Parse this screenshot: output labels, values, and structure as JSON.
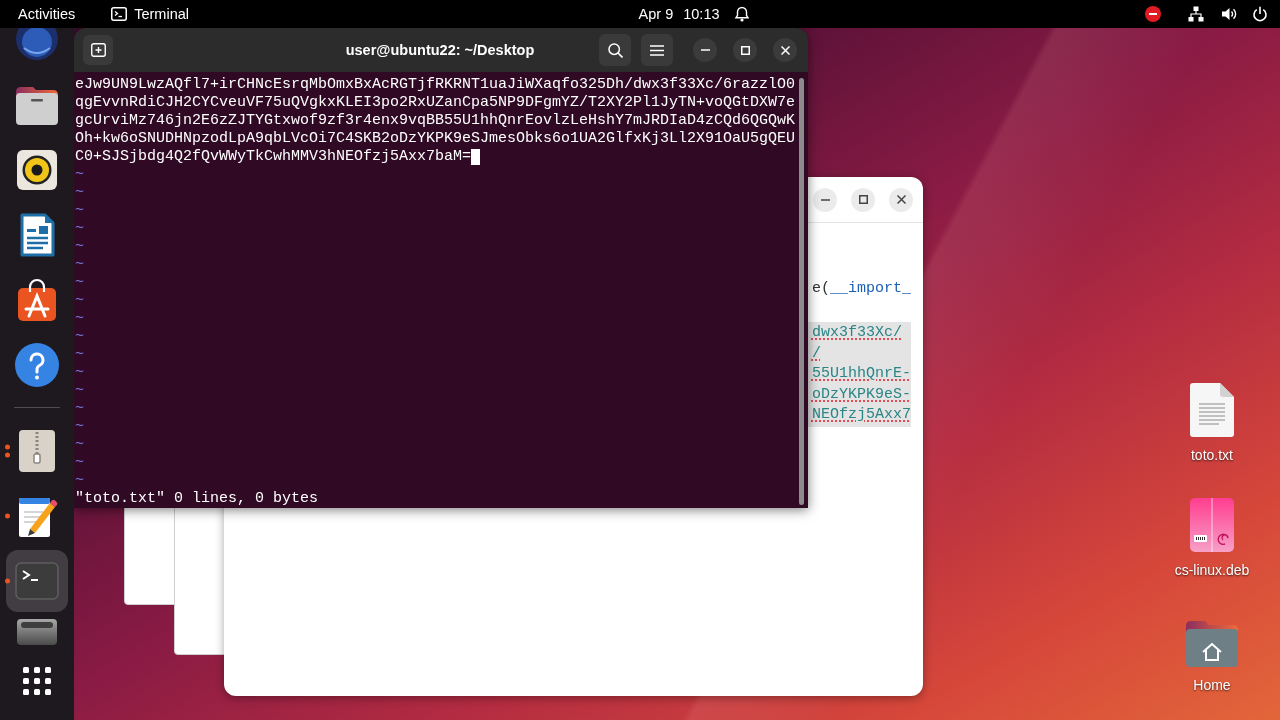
{
  "top_bar": {
    "activities": "Activities",
    "app_menu": "Terminal",
    "date": "Apr 9",
    "time": "10:13"
  },
  "dock": {
    "pinned": [
      {
        "kind": "globe",
        "selected": false,
        "running": false,
        "multiple_windows": false
      },
      {
        "kind": "folder",
        "selected": false,
        "running": false,
        "multiple_windows": false
      },
      {
        "kind": "speaker",
        "selected": false,
        "running": false,
        "multiple_windows": false
      },
      {
        "kind": "writer",
        "selected": false,
        "running": false,
        "multiple_windows": false
      },
      {
        "kind": "store",
        "selected": false,
        "running": false,
        "multiple_windows": false
      },
      {
        "kind": "help",
        "selected": false,
        "running": false,
        "multiple_windows": false
      }
    ],
    "running_apps": [
      {
        "kind": "archive",
        "selected": false,
        "running": true,
        "multiple_windows": true
      },
      {
        "kind": "editor",
        "selected": false,
        "running": true,
        "multiple_windows": false
      },
      {
        "kind": "terminal",
        "selected": true,
        "running": true,
        "multiple_windows": false
      },
      {
        "kind": "drive",
        "selected": false,
        "running": false,
        "multiple_windows": false
      }
    ]
  },
  "terminal": {
    "title": "user@ubuntu22: ~/Desktop",
    "rows": [
      "eJw9UN9LwzAQfl7+irCHNcEsrqMbOmxBxAcRGTjfRKRNT1uaJiWXaqfo325Dh/dwx3f33Xc/6razzlO0",
      "qgEvvnRdiCJH2CYCveuVF75uQVgkxKLEI3po2RxUZanCpa5NP9DFgmYZ/T2XY2Pl1JyTN+voQGtDXW7e",
      "gcUrviMz746jn2E6zZJTYGtxwof9zf3r4enx9vqBB55U1hhQnrEovlzLeHshY7mJRDIaD4zCQd6QGQwK",
      "Oh+kw6oSNUDHNpzodLpA9qbLVcOi7C4SKB2oDzYKPK9eSJmesObks6o1UA2GlfxKj3Ll2X91OaU5gQEU",
      "C0+SJSjbdg4Q2fQvWWyTkCwhMMV3hNEOfzj5Axx7baM="
    ],
    "cursor": true,
    "empty_rows": [
      "~",
      "~",
      "~",
      "~",
      "~",
      "~",
      "~",
      "~",
      "~",
      "~",
      "~",
      "~",
      "~",
      "~",
      "~",
      "~",
      "~",
      "~"
    ],
    "status_line": "\"toto.txt\" 0 lines, 0 bytes"
  },
  "back_window": {
    "code_tokens": [
      {
        "kind": "plain",
        "text": "e("
      },
      {
        "kind": "builtin",
        "text": "__import_"
      }
    ],
    "selection": true,
    "spellcheck_marks": true,
    "selected_lines": [
      "dwx3f33Xc/",
      "/",
      "55U1hhQnrE-",
      "oDzYKPK9eS-",
      "NEOfzj5Axx7"
    ]
  },
  "desktop_icons": [
    {
      "kind": "text-file",
      "label": "toto.txt"
    },
    {
      "kind": "package",
      "label": "cs-linux.deb"
    },
    {
      "kind": "home-folder",
      "label": "Home"
    }
  ]
}
